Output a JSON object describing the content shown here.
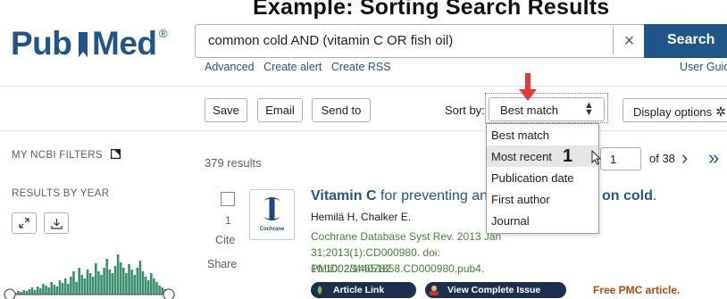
{
  "banner": {
    "text": "Example: Sorting Search Results"
  },
  "logo": {
    "pub": "Pub",
    "med": "Med",
    "reg": "®"
  },
  "search": {
    "query": "common cold AND (vitamin C OR fish oil)",
    "button": "Search",
    "clear_icon": "×"
  },
  "links": {
    "advanced": "Advanced",
    "create_alert": "Create alert",
    "create_rss": "Create RSS",
    "user_guide": "User Guide"
  },
  "toolbar": {
    "save": "Save",
    "email": "Email",
    "send_to": "Send to",
    "sort_label": "Sort by:",
    "sort_value": "Best match",
    "sort_arrows": "⬥",
    "display_options": "Display options",
    "gear_icon": "✲"
  },
  "sort_menu": {
    "options": [
      "Best match",
      "Most recent",
      "Publication date",
      "First author",
      "Journal"
    ],
    "hovered_index": 1,
    "annotation": "1"
  },
  "sidebar": {
    "my_filters": "MY NCBI FILTERS",
    "results_by_year": "RESULTS BY YEAR"
  },
  "results": {
    "count": "379 results",
    "page": "1",
    "of_pages": "of 38",
    "next": "›",
    "last": "»"
  },
  "article": {
    "number": "1",
    "cite": "Cite",
    "share": "Share",
    "journal_logo": "Cochrane",
    "title_bold": "Vitamin C",
    "title_rest": " for preventing and",
    "title_tail": "on cold",
    "title_end": ".",
    "authors": "Hemilä H, Chalker E.",
    "citation": "Cochrane Database Syst Rev. 2013 Jan 31;2013(1):CD000980. doi: 10.1002/14651858.CD000980.pub4.",
    "pmid": "PMID: 23440782",
    "article_link": "Article Link",
    "view_issue": "View Complete Issue",
    "free_pmc": "Free PMC article."
  },
  "colors": {
    "brand": "#20558a",
    "arrow": "#e53935",
    "pill": "#1d2f4f",
    "free_pmc": "#b1480e",
    "citation": "#4a7e3e"
  }
}
